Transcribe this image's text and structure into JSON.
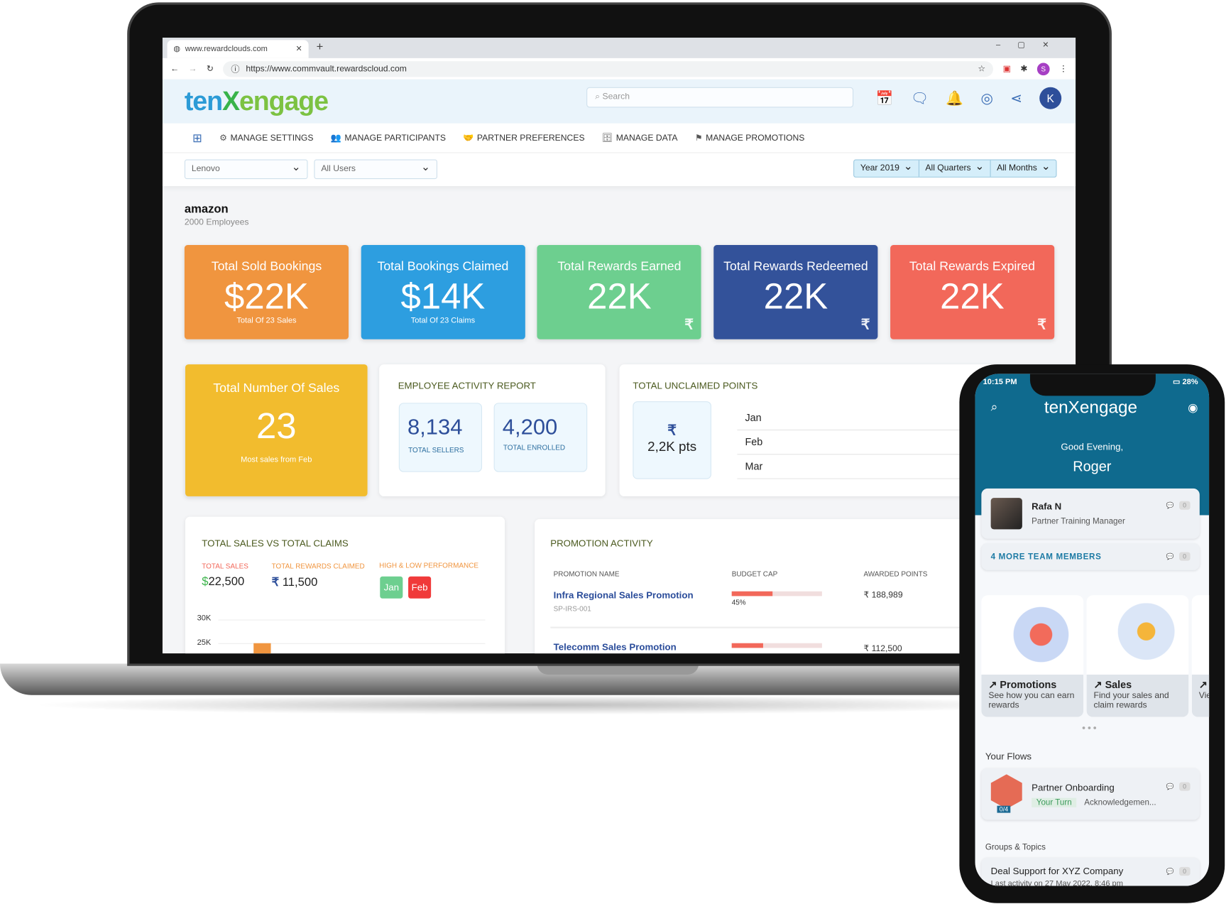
{
  "browser": {
    "tab_title": "www.rewardclouds.com",
    "url": "https://www.commvault.rewardscloud.com",
    "profile_initial": "S"
  },
  "app": {
    "logo": {
      "a": "ten",
      "b": "X",
      "c": "engage"
    },
    "search_placeholder": "Search",
    "user_initial": "K",
    "nav": [
      "MANAGE SETTINGS",
      "MANAGE PARTICIPANTS",
      "PARTNER PREFERENCES",
      "MANAGE DATA",
      "MANAGE PROMOTIONS"
    ],
    "filters": {
      "company": "Lenovo",
      "users": "All Users",
      "year": "Year 2019",
      "quarter": "All Quarters",
      "month": "All Months"
    },
    "company": {
      "name": "amazon",
      "employees": "2000 Employees"
    },
    "kpis": [
      {
        "title": "Total Sold Bookings",
        "value": "$22K",
        "sub": "Total Of 23 Sales",
        "color": "#f0953f"
      },
      {
        "title": "Total Bookings Claimed",
        "value": "$14K",
        "sub": "Total Of 23 Claims",
        "color": "#2d9ee0"
      },
      {
        "title": "Total Rewards Earned",
        "value": "22K",
        "sub": "",
        "color": "#6dcf8f"
      },
      {
        "title": "Total Rewards Redeemed",
        "value": "22K",
        "sub": "",
        "color": "#33529a"
      },
      {
        "title": "Total Rewards Expired",
        "value": "22K",
        "sub": "",
        "color": "#f2685a"
      }
    ],
    "sales_count": {
      "title": "Total Number Of Sales",
      "value": "23",
      "sub": "Most sales from Feb",
      "color": "#f2bc2e"
    },
    "employee_activity": {
      "title": "EMPLOYEE ACTIVITY REPORT",
      "sellers": "8,134",
      "sellers_label": "TOTAL SELLERS",
      "enrolled": "4,200",
      "enrolled_label": "TOTAL ENROLLED"
    },
    "unclaimed": {
      "title": "TOTAL UNCLAIMED POINTS",
      "value": "2,2K pts",
      "months": [
        "Jan",
        "Feb",
        "Mar"
      ]
    },
    "sales_claims": {
      "title": "TOTAL SALES VS TOTAL CLAIMS",
      "sales_label": "TOTAL SALES",
      "sales_value": "22,500",
      "sales_currency": "$",
      "claimed_label": "TOTAL REWARDS CLAIMED",
      "claimed_value": "11,500",
      "perf_label": "HIGH & LOW PERFORMANCE",
      "high": "Jan",
      "low": "Feb",
      "y_ticks": [
        "30K",
        "25K"
      ]
    },
    "promotion": {
      "title": "PROMOTION ACTIVITY",
      "cols": [
        "PROMOTION NAME",
        "BUDGET CAP",
        "AWARDED POINTS"
      ],
      "rows": [
        {
          "name": "Infra Regional Sales Promotion",
          "code": "SP-IRS-001",
          "budget_pct": 45,
          "budget_label": "45%",
          "points": "188,989"
        },
        {
          "name": "Telecomm Sales Promotion",
          "code": "",
          "budget_pct": 35,
          "budget_label": "",
          "points": "112,500"
        }
      ]
    }
  },
  "phone": {
    "time": "10:15 PM",
    "battery": "28%",
    "logo": "tenXengage",
    "greeting": "Good Evening,",
    "user": "Roger",
    "contact": {
      "name": "Rafa N",
      "role": "Partner Training Manager",
      "count": "0"
    },
    "more": {
      "label": "4 MORE TEAM MEMBERS",
      "count": "0"
    },
    "tiles": [
      {
        "title": "Promotions",
        "desc": "See how you can earn rewards"
      },
      {
        "title": "Sales",
        "desc": "Find your sales and claim rewards"
      },
      {
        "title": "",
        "desc": "Vie you"
      }
    ],
    "flows_title": "Your Flows",
    "flow": {
      "name": "Partner Onboarding",
      "badge": "Your Turn",
      "status": "Acknowledgemen...",
      "progress": "0/4",
      "count": "0"
    },
    "groups_title": "Groups & Topics",
    "group": {
      "name": "Deal Support for XYZ Company",
      "activity": "Last activity on 27 May 2022, 8:46 pm",
      "count": "0"
    }
  }
}
